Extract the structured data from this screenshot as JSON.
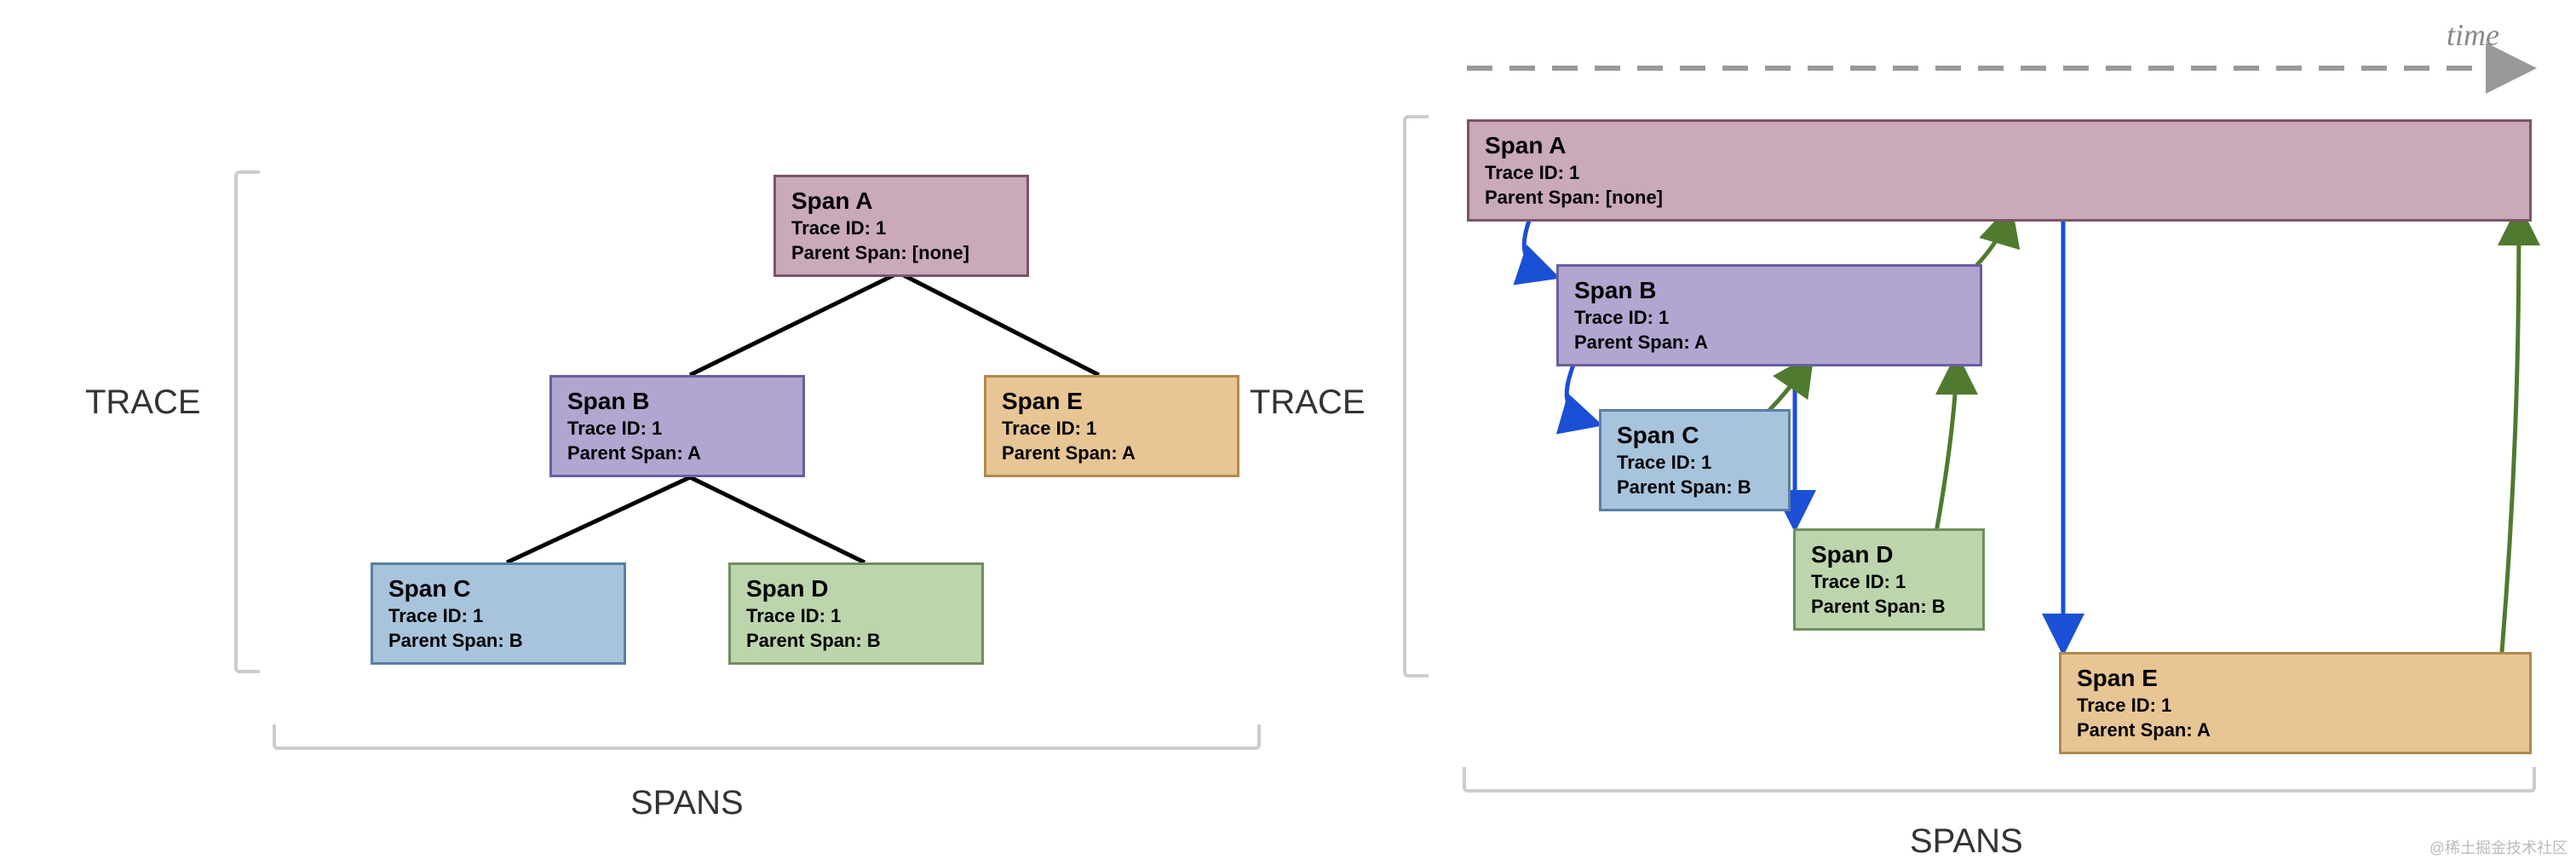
{
  "labels": {
    "trace": "TRACE",
    "spans": "SPANS",
    "time": "time"
  },
  "spans": {
    "a": {
      "title": "Span A",
      "trace": "Trace ID: 1",
      "parent": "Parent Span: [none]"
    },
    "b": {
      "title": "Span B",
      "trace": "Trace ID: 1",
      "parent": "Parent Span: A"
    },
    "c": {
      "title": "Span C",
      "trace": "Trace ID: 1",
      "parent": "Parent Span: B"
    },
    "d": {
      "title": "Span D",
      "trace": "Trace ID: 1",
      "parent": "Parent Span: B"
    },
    "e": {
      "title": "Span E",
      "trace": "Trace ID: 1",
      "parent": "Parent Span: A"
    }
  },
  "watermark": "@稀土掘金技术社区",
  "chart_data": {
    "type": "tree_and_gantt",
    "left_view": "hierarchical_tree",
    "right_view": "timeline_gantt",
    "tree": {
      "root": "Span A",
      "children": {
        "Span A": [
          "Span B",
          "Span E"
        ],
        "Span B": [
          "Span C",
          "Span D"
        ],
        "Span C": [],
        "Span D": [],
        "Span E": []
      }
    },
    "spans_detail": [
      {
        "name": "Span A",
        "trace_id": 1,
        "parent": null,
        "color": "#c9a9ba"
      },
      {
        "name": "Span B",
        "trace_id": 1,
        "parent": "A",
        "color": "#b0a6d0"
      },
      {
        "name": "Span C",
        "trace_id": 1,
        "parent": "B",
        "color": "#a8c4dd"
      },
      {
        "name": "Span D",
        "trace_id": 1,
        "parent": "B",
        "color": "#bcd5ad"
      },
      {
        "name": "Span E",
        "trace_id": 1,
        "parent": "A",
        "color": "#e8c594"
      }
    ],
    "timeline": [
      {
        "name": "Span A",
        "start": 0,
        "end": 100,
        "row": 0
      },
      {
        "name": "Span B",
        "start": 8,
        "end": 55,
        "row": 1
      },
      {
        "name": "Span C",
        "start": 12,
        "end": 35,
        "row": 2
      },
      {
        "name": "Span D",
        "start": 35,
        "end": 58,
        "row": 3
      },
      {
        "name": "Span E",
        "start": 62,
        "end": 100,
        "row": 4
      }
    ]
  }
}
